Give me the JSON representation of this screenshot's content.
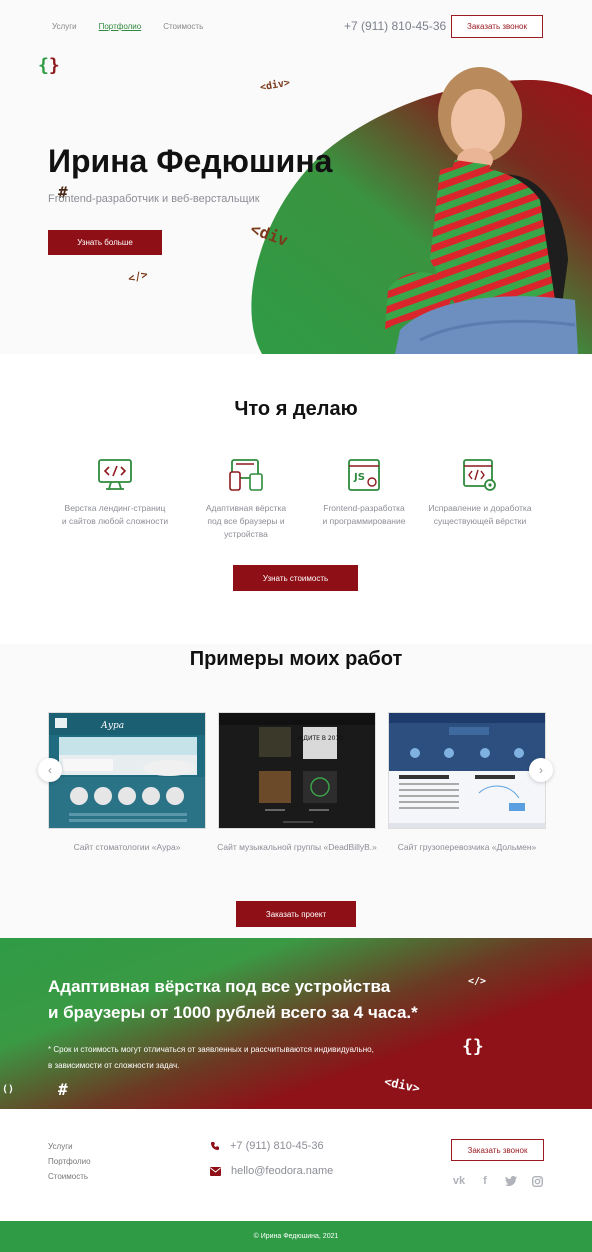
{
  "nav": {
    "items": [
      {
        "label": "Услуги",
        "active": false
      },
      {
        "label": "Портфолио",
        "active": true
      },
      {
        "label": "Стоимость",
        "active": false
      }
    ],
    "phone": "+7 (911) 810-45-36",
    "call_button": "Заказать звонок"
  },
  "hero": {
    "title": "Ирина Федюшина",
    "subtitle": "Frontend-разработчик и веб-верстальщик",
    "button": "Узнать больше",
    "decor": [
      "{}",
      "<div>",
      "#",
      "<div",
      "</>"
    ]
  },
  "services": {
    "title": "Что я делаю",
    "items": [
      {
        "icon": "code-monitor-icon",
        "line1": "Верстка лендинг-страниц",
        "line2": "и сайтов любой сложности"
      },
      {
        "icon": "devices-icon",
        "line1": "Адаптивная вёрстка",
        "line2": "под все браузеры и устройства"
      },
      {
        "icon": "js-window-icon",
        "line1": "Frontend-разработка",
        "line2": "и программирование"
      },
      {
        "icon": "code-settings-icon",
        "line1": "Исправление и доработка",
        "line2": "существующей вёрстки"
      }
    ],
    "button": "Узнать стоимость"
  },
  "portfolio": {
    "title": "Примеры моих работ",
    "works": [
      {
        "caption": "Сайт стоматологии «Аура»"
      },
      {
        "caption": "Сайт музыкальной группы «DeadBillyB.»",
        "poster_text": "ЖДИТЕ В 2019"
      },
      {
        "caption": "Сайт грузоперевозчика «Дольмен»"
      }
    ],
    "button": "Заказать проект"
  },
  "promo": {
    "line1": "Адаптивная вёрстка под все устройства",
    "line2": "и браузеры от 1000 рублей всего за 4 часа.*",
    "note1": "* Срок и стоимость могут отличаться от заявленных и рассчитываются индивидуально,",
    "note2": "в зависимости от сложности задач."
  },
  "footer": {
    "links": [
      "Услуги",
      "Портфолио",
      "Стоимость"
    ],
    "phone": "+7 (911) 810-45-36",
    "email": "hello@feodora.name",
    "call_button": "Заказать звонок",
    "social": [
      "vk-icon",
      "facebook-icon",
      "twitter-icon",
      "instagram-icon"
    ],
    "copyright": "© Ирина Федюшина, 2021"
  },
  "colors": {
    "accent": "#8e0f16",
    "green": "#2f9b45",
    "text_muted": "#8c8e96"
  }
}
